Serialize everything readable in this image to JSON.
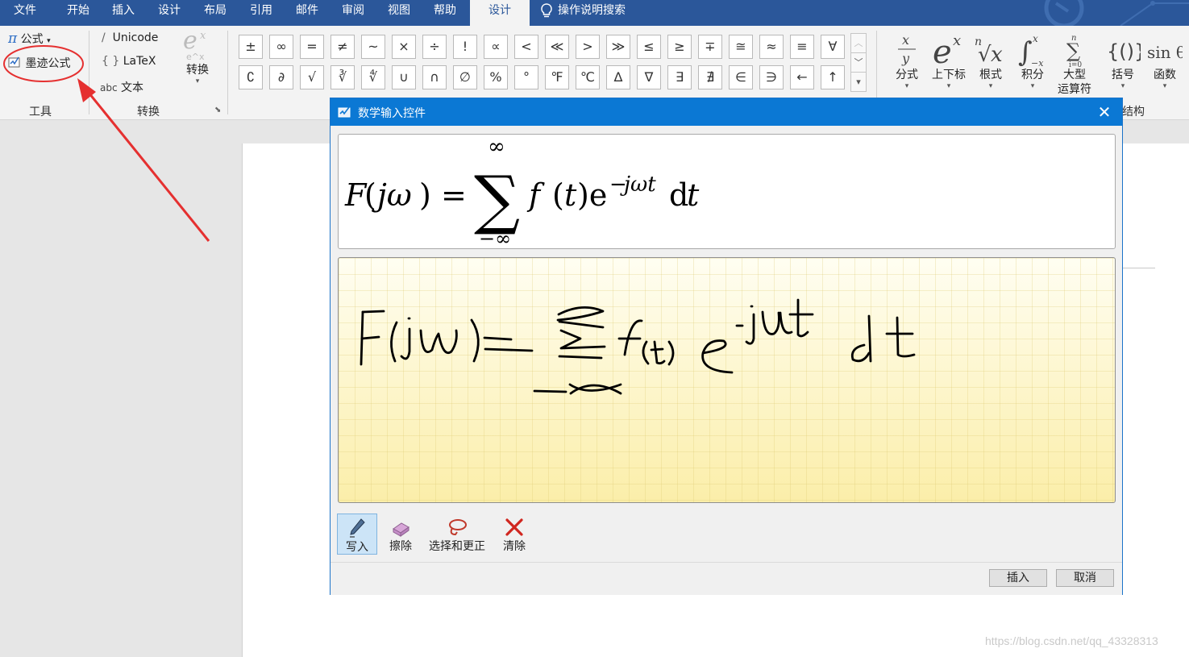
{
  "tabs": [
    "文件",
    "开始",
    "插入",
    "设计",
    "布局",
    "引用",
    "邮件",
    "审阅",
    "视图",
    "帮助",
    "设计"
  ],
  "tell_me": "操作说明搜索",
  "tools_group": {
    "equation_label": "公式",
    "ink_equation_label": "墨迹公式",
    "group_label": "工具"
  },
  "conversions_group": {
    "unicode_label": "Unicode",
    "latex_label": "LaTeX",
    "text_label": "文本",
    "abc_label": "abc",
    "convert_label": "转换",
    "group_label": "转换"
  },
  "symbols_row1": [
    "±",
    "∞",
    "=",
    "≠",
    "~",
    "×",
    "÷",
    "!",
    "∝",
    "<",
    "≪",
    ">",
    "≫",
    "≤",
    "≥",
    "∓",
    "≅",
    "≈",
    "≡",
    "∀"
  ],
  "symbols_row2": [
    "∁",
    "∂",
    "√",
    "∛",
    "∜",
    "∪",
    "∩",
    "∅",
    "%",
    "°",
    "℉",
    "℃",
    "∆",
    "∇",
    "∃",
    "∄",
    "∈",
    "∋",
    "←",
    "↑"
  ],
  "structures": [
    {
      "name": "fraction",
      "label": "分式"
    },
    {
      "name": "script",
      "label": "上下标"
    },
    {
      "name": "radical",
      "label": "根式"
    },
    {
      "name": "integral",
      "label": "积分"
    },
    {
      "name": "large-operator",
      "label": "大型\n运算符"
    },
    {
      "name": "bracket",
      "label": "括号"
    },
    {
      "name": "function",
      "label": "函数"
    }
  ],
  "structures_group_label": "结构",
  "dialog": {
    "title": "数学输入控件",
    "preview_equation": "F(jω) = Σ f(t)e^{−jωt}dt",
    "preview_upper_limit": "∞",
    "preview_lower_limit": "−∞",
    "tools": [
      "写入",
      "擦除",
      "选择和更正",
      "清除"
    ],
    "insert_label": "插入",
    "cancel_label": "取消"
  },
  "watermark": "https://blog.csdn.net/qq_43328313",
  "colors": {
    "ribbon_blue": "#2b579a",
    "dialog_title_blue": "#0b78d4",
    "annotation_red": "#e53030",
    "ink_pad_yellow": "#fdf6c8"
  }
}
